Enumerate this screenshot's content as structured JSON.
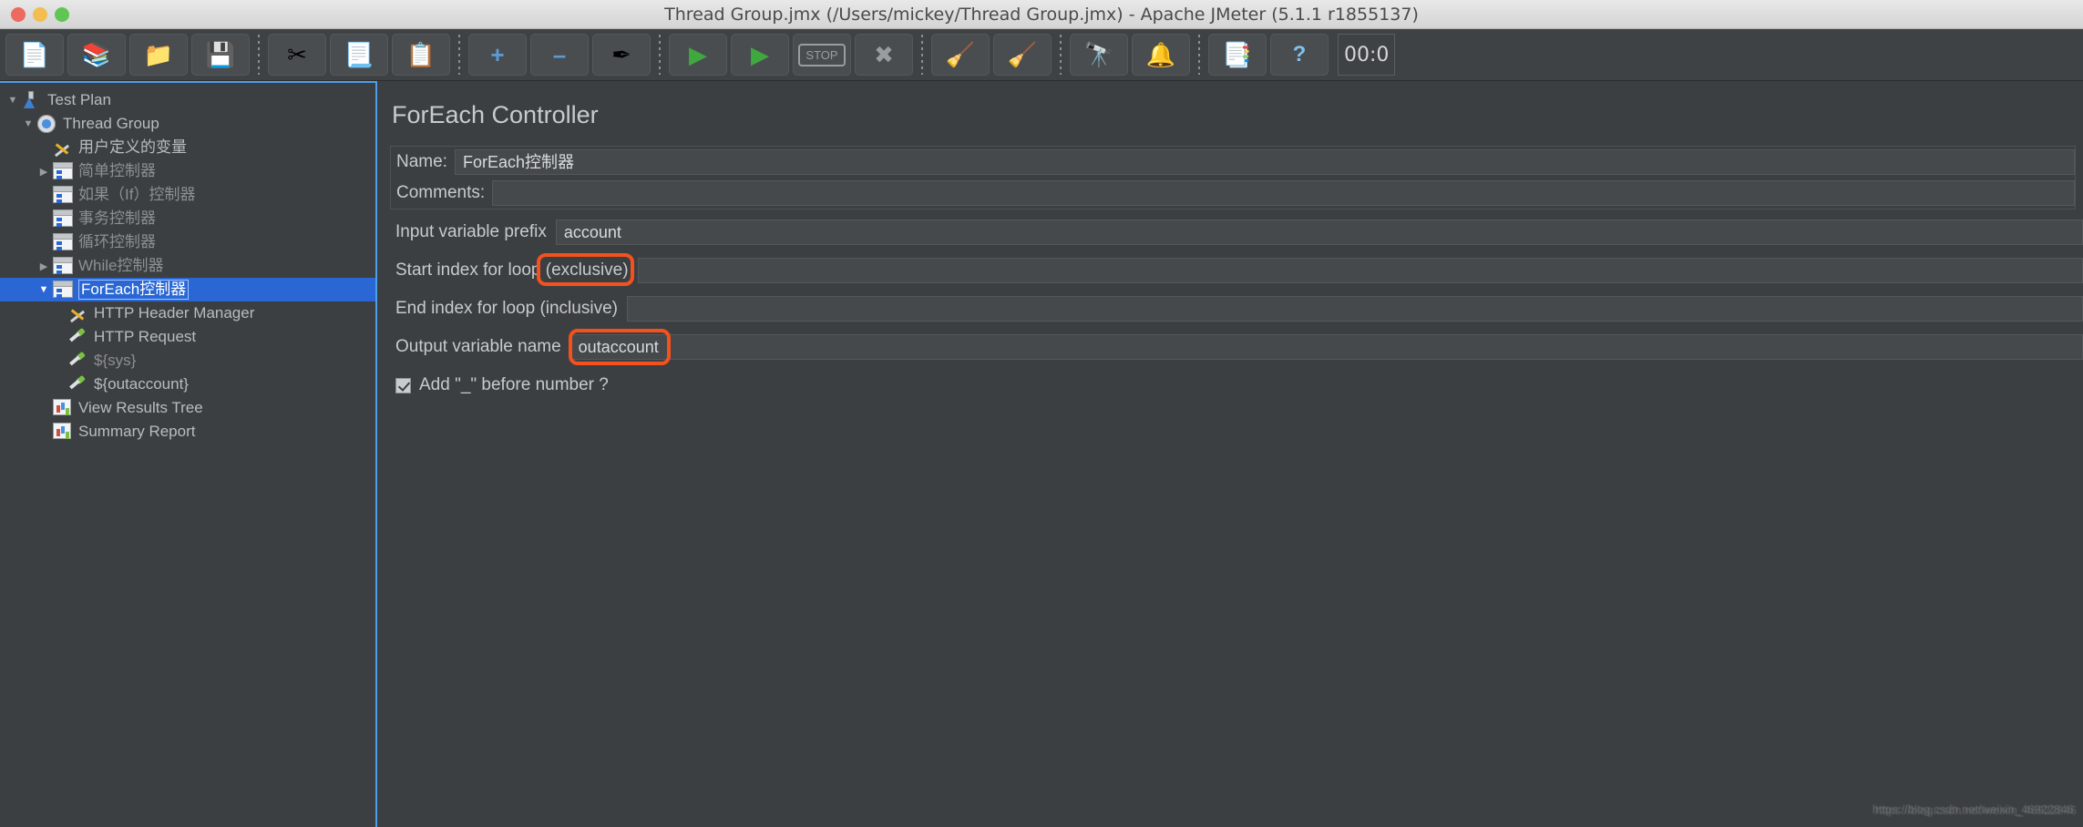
{
  "window": {
    "title": "Thread Group.jmx (/Users/mickey/Thread Group.jmx) - Apache JMeter (5.1.1 r1855137)",
    "traffic_lights": [
      "close",
      "minimize",
      "zoom"
    ]
  },
  "toolbar": {
    "timer": "00:0",
    "buttons": [
      {
        "name": "new-button",
        "icon": "new-document-icon",
        "glyph": "📄"
      },
      {
        "name": "templates-button",
        "icon": "templates-icon",
        "glyph": "📚"
      },
      {
        "name": "open-button",
        "icon": "open-folder-icon",
        "glyph": "📁"
      },
      {
        "name": "save-button",
        "icon": "save-disk-icon",
        "glyph": "💾"
      },
      {
        "separator": true
      },
      {
        "name": "cut-button",
        "icon": "scissors-icon",
        "glyph": "✂"
      },
      {
        "name": "copy-button",
        "icon": "copy-icon",
        "glyph": "📃"
      },
      {
        "name": "paste-button",
        "icon": "clipboard-paste-icon",
        "glyph": "📋"
      },
      {
        "separator": true
      },
      {
        "name": "expand-all-button",
        "icon": "plus-icon",
        "glyph": "+"
      },
      {
        "name": "collapse-all-button",
        "icon": "minus-icon",
        "glyph": "–"
      },
      {
        "name": "toggle-button",
        "icon": "toggle-pipette-icon",
        "glyph": "✒"
      },
      {
        "separator": true
      },
      {
        "name": "start-button",
        "icon": "play-icon",
        "glyph": "▶"
      },
      {
        "name": "start-no-pauses-button",
        "icon": "play-no-timers-icon",
        "glyph": "▶"
      },
      {
        "name": "stop-button",
        "icon": "stop-icon",
        "glyph": "STOP"
      },
      {
        "name": "shutdown-button",
        "icon": "shutdown-x-icon",
        "glyph": "✖"
      },
      {
        "separator": true
      },
      {
        "name": "clear-button",
        "icon": "gear-broom-icon",
        "glyph": "🧹"
      },
      {
        "name": "clear-all-button",
        "icon": "gear-broom-all-icon",
        "glyph": "🧹"
      },
      {
        "separator": true
      },
      {
        "name": "search-button",
        "icon": "binoculars-icon",
        "glyph": "🔭"
      },
      {
        "name": "reset-search-button",
        "icon": "yellow-bell-icon",
        "glyph": "🔔"
      },
      {
        "separator": true
      },
      {
        "name": "function-helper-button",
        "icon": "notepad-lines-icon",
        "glyph": "📑"
      },
      {
        "name": "help-button",
        "icon": "blue-question-book-icon",
        "glyph": "?"
      }
    ]
  },
  "tree": {
    "items": [
      {
        "label": "Test Plan",
        "depth": 0,
        "twisty": "down",
        "icon": "flask-icon",
        "state": "normal",
        "selected": false
      },
      {
        "label": "Thread Group",
        "depth": 1,
        "twisty": "down",
        "icon": "gear-icon",
        "state": "normal",
        "selected": false
      },
      {
        "label": "用户定义的变量",
        "depth": 2,
        "twisty": "none",
        "icon": "wrench-icon",
        "state": "normal",
        "selected": false
      },
      {
        "label": "简单控制器",
        "depth": 2,
        "twisty": "right",
        "icon": "controller-icon",
        "state": "disabled",
        "selected": false
      },
      {
        "label": "如果（If）控制器",
        "depth": 2,
        "twisty": "none",
        "icon": "controller-icon",
        "state": "disabled",
        "selected": false
      },
      {
        "label": "事务控制器",
        "depth": 2,
        "twisty": "none",
        "icon": "controller-icon",
        "state": "disabled",
        "selected": false
      },
      {
        "label": "循环控制器",
        "depth": 2,
        "twisty": "none",
        "icon": "controller-icon",
        "state": "disabled",
        "selected": false
      },
      {
        "label": "While控制器",
        "depth": 2,
        "twisty": "right",
        "icon": "controller-icon",
        "state": "disabled",
        "selected": false
      },
      {
        "label": "ForEach控制器",
        "depth": 2,
        "twisty": "down",
        "icon": "controller-icon",
        "state": "normal",
        "selected": true
      },
      {
        "label": "HTTP Header Manager",
        "depth": 3,
        "twisty": "none",
        "icon": "wrench-icon",
        "state": "normal",
        "selected": false
      },
      {
        "label": "HTTP Request",
        "depth": 3,
        "twisty": "none",
        "icon": "pipette-icon",
        "state": "normal",
        "selected": false
      },
      {
        "label": "${sys}",
        "depth": 3,
        "twisty": "none",
        "icon": "pipette-icon",
        "state": "disabled",
        "selected": false
      },
      {
        "label": "${outaccount}",
        "depth": 3,
        "twisty": "none",
        "icon": "pipette-icon",
        "state": "normal",
        "selected": false
      },
      {
        "label": "View Results Tree",
        "depth": 2,
        "twisty": "none",
        "icon": "chart-icon",
        "state": "normal",
        "selected": false
      },
      {
        "label": "Summary Report",
        "depth": 2,
        "twisty": "none",
        "icon": "chart-icon",
        "state": "normal",
        "selected": false
      }
    ]
  },
  "panel": {
    "title": "ForEach Controller",
    "name_label": "Name:",
    "name_value": "ForEach控制器",
    "comments_label": "Comments:",
    "comments_value": "",
    "input_prefix_label": "Input variable prefix",
    "input_prefix_value": "account",
    "start_index_label": "Start index for loop (exclusive)",
    "start_index_value": "",
    "end_index_label": "End index for loop (inclusive)",
    "end_index_value": "",
    "output_var_label": "Output variable name",
    "output_var_value": "outaccount",
    "add_underscore_label": "Add \"_\" before number ?",
    "add_underscore_checked": true
  },
  "annotations": {
    "color": "#f4511e",
    "boxes": [
      {
        "name": "annotation-exclusive",
        "target": "(exclusive) in start index label"
      },
      {
        "name": "annotation-outaccount",
        "target": "outaccount output variable value"
      }
    ]
  },
  "watermark": {
    "line": "https://blog.csdn.net/weixin_46922846"
  }
}
